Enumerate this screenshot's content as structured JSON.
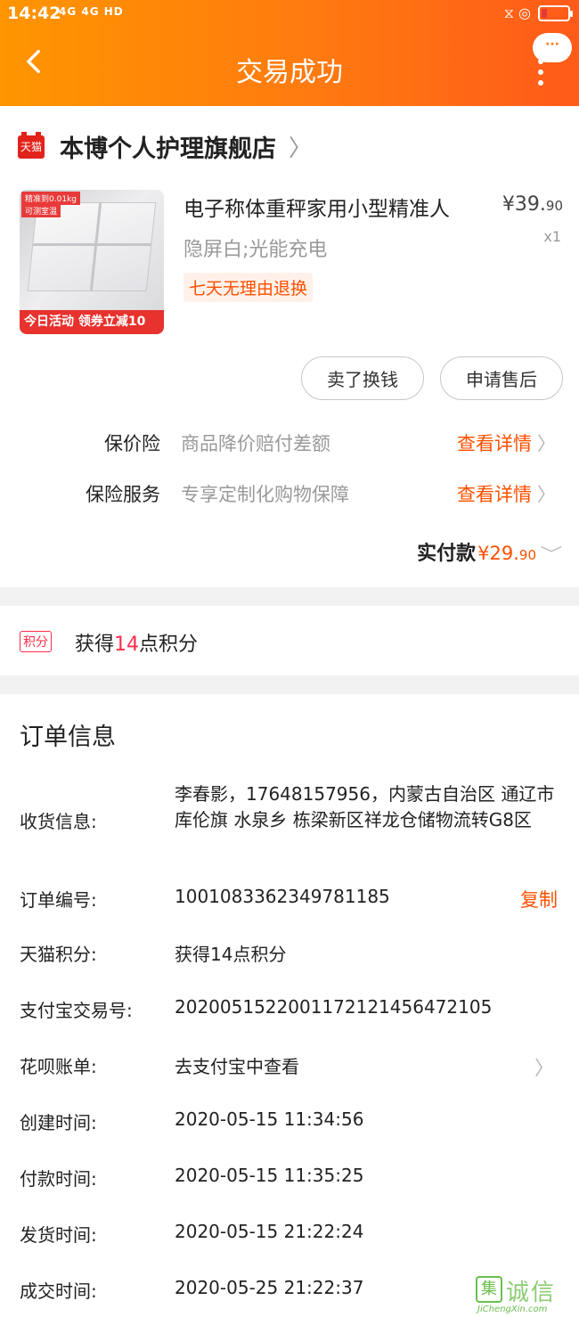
{
  "status_bar": {
    "time": "14:42",
    "signal": "4G 4G HD",
    "right_icons": "⧖ ◎"
  },
  "header": {
    "title": "交易成功",
    "more_bubble": "···"
  },
  "shop": {
    "badge": "天猫",
    "name": "本博个人护理旗舰店"
  },
  "product": {
    "image_tag1": "精准到0.01kg",
    "image_tag2": "可测室温",
    "image_banner": "今日活动 领券立减10",
    "title": "电子称体重秤家用小型精准人",
    "sku": "隐屏白;光能充电",
    "price_symbol": "¥",
    "price_int": "39.",
    "price_dec": "90",
    "quantity": "x1",
    "return_policy": "七天无理由退换"
  },
  "actions": {
    "sell": "卖了换钱",
    "after_sale": "申请售后"
  },
  "services": [
    {
      "label": "保价险",
      "desc": "商品降价赔付差额",
      "link": "查看详情"
    },
    {
      "label": "保险服务",
      "desc": "专享定制化购物保障",
      "link": "查看详情"
    }
  ],
  "payment": {
    "label": "实付款",
    "symbol": "¥",
    "int": "29.",
    "dec": "90"
  },
  "points": {
    "badge": "积分",
    "prefix": "获得",
    "count": "14",
    "suffix": "点积分"
  },
  "order_info": {
    "title": "订单信息",
    "receiver_label": "收货信息:",
    "receiver_value": "李春影，17648157956，内蒙古自治区 通辽市 库伦旗 水泉乡 栋梁新区祥龙仓储物流转G8区",
    "order_no_label": "订单编号:",
    "order_no_value": "1001083362349781185",
    "copy": "复制",
    "points_label": "天猫积分:",
    "points_value": "获得14点积分",
    "alipay_label": "支付宝交易号:",
    "alipay_value": "2020051522001172121456472105",
    "huabei_label": "花呗账单:",
    "huabei_value": "去支付宝中查看",
    "created_label": "创建时间:",
    "created_value": "2020-05-15 11:34:56",
    "paid_label": "付款时间:",
    "paid_value": "2020-05-15 11:35:25",
    "shipped_label": "发货时间:",
    "shipped_value": "2020-05-15 21:22:24",
    "closed_label": "成交时间:",
    "closed_value": "2020-05-25 21:22:37"
  },
  "watermark": {
    "box": "集",
    "cn": "诚信",
    "en": "JiChengXin.com"
  },
  "colors": {
    "header_start": "#ff9500",
    "header_end": "#ff5a1a",
    "accent": "#ff5000",
    "points_red": "#ff2d4a"
  }
}
